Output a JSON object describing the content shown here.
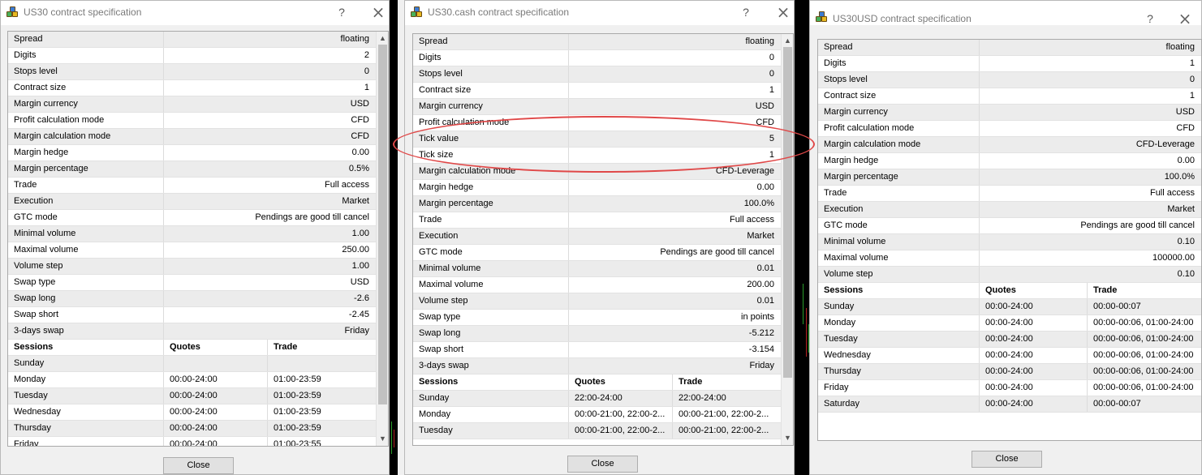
{
  "dialogs": [
    {
      "title": "US30 contract specification",
      "help": "?",
      "close_button": "Close",
      "specs": [
        {
          "k": "Spread",
          "v": "floating"
        },
        {
          "k": "Digits",
          "v": "2"
        },
        {
          "k": "Stops level",
          "v": "0"
        },
        {
          "k": "Contract size",
          "v": "1"
        },
        {
          "k": "Margin currency",
          "v": "USD"
        },
        {
          "k": "Profit calculation mode",
          "v": "CFD"
        },
        {
          "k": "Margin calculation mode",
          "v": "CFD"
        },
        {
          "k": "Margin hedge",
          "v": "0.00"
        },
        {
          "k": "Margin percentage",
          "v": "0.5%"
        },
        {
          "k": "Trade",
          "v": "Full access"
        },
        {
          "k": "Execution",
          "v": "Market"
        },
        {
          "k": "GTC mode",
          "v": "Pendings are good till cancel"
        },
        {
          "k": "Minimal volume",
          "v": "1.00"
        },
        {
          "k": "Maximal volume",
          "v": "250.00"
        },
        {
          "k": "Volume step",
          "v": "1.00"
        },
        {
          "k": "Swap type",
          "v": "USD"
        },
        {
          "k": "Swap long",
          "v": "-2.6"
        },
        {
          "k": "Swap short",
          "v": "-2.45"
        },
        {
          "k": "3-days swap",
          "v": "Friday"
        }
      ],
      "sessions_header": [
        "Sessions",
        "Quotes",
        "Trade"
      ],
      "sessions": [
        [
          "Sunday",
          "",
          ""
        ],
        [
          "Monday",
          "00:00-24:00",
          "01:00-23:59"
        ],
        [
          "Tuesday",
          "00:00-24:00",
          "01:00-23:59"
        ],
        [
          "Wednesday",
          "00:00-24:00",
          "01:00-23:59"
        ],
        [
          "Thursday",
          "00:00-24:00",
          "01:00-23:59"
        ],
        [
          "Friday",
          "00:00-24:00",
          "01:00-23:55"
        ]
      ]
    },
    {
      "title": "US30.cash contract specification",
      "help": "?",
      "close_button": "Close",
      "specs": [
        {
          "k": "Spread",
          "v": "floating"
        },
        {
          "k": "Digits",
          "v": "0"
        },
        {
          "k": "Stops level",
          "v": "0"
        },
        {
          "k": "Contract size",
          "v": "1"
        },
        {
          "k": "Margin currency",
          "v": "USD"
        },
        {
          "k": "Profit calculation mode",
          "v": "CFD"
        },
        {
          "k": "Tick value",
          "v": "5"
        },
        {
          "k": "Tick size",
          "v": "1"
        },
        {
          "k": "Margin calculation mode",
          "v": "CFD-Leverage"
        },
        {
          "k": "Margin hedge",
          "v": "0.00"
        },
        {
          "k": "Margin percentage",
          "v": "100.0%"
        },
        {
          "k": "Trade",
          "v": "Full access"
        },
        {
          "k": "Execution",
          "v": "Market"
        },
        {
          "k": "GTC mode",
          "v": "Pendings are good till cancel"
        },
        {
          "k": "Minimal volume",
          "v": "0.01"
        },
        {
          "k": "Maximal volume",
          "v": "200.00"
        },
        {
          "k": "Volume step",
          "v": "0.01"
        },
        {
          "k": "Swap type",
          "v": "in points"
        },
        {
          "k": "Swap long",
          "v": "-5.212"
        },
        {
          "k": "Swap short",
          "v": "-3.154"
        },
        {
          "k": "3-days swap",
          "v": "Friday"
        }
      ],
      "sessions_header": [
        "Sessions",
        "Quotes",
        "Trade"
      ],
      "sessions": [
        [
          "Sunday",
          "22:00-24:00",
          "22:00-24:00"
        ],
        [
          "Monday",
          "00:00-21:00, 22:00-2...",
          "00:00-21:00, 22:00-2..."
        ],
        [
          "Tuesday",
          "00:00-21:00, 22:00-2...",
          "00:00-21:00, 22:00-2..."
        ]
      ]
    },
    {
      "title": "US30USD contract specification",
      "help": "?",
      "close_button": "Close",
      "specs": [
        {
          "k": "Spread",
          "v": "floating"
        },
        {
          "k": "Digits",
          "v": "1"
        },
        {
          "k": "Stops level",
          "v": "0"
        },
        {
          "k": "Contract size",
          "v": "1"
        },
        {
          "k": "Margin currency",
          "v": "USD"
        },
        {
          "k": "Profit calculation mode",
          "v": "CFD"
        },
        {
          "k": "Margin calculation mode",
          "v": "CFD-Leverage"
        },
        {
          "k": "Margin hedge",
          "v": "0.00"
        },
        {
          "k": "Margin percentage",
          "v": "100.0%"
        },
        {
          "k": "Trade",
          "v": "Full access"
        },
        {
          "k": "Execution",
          "v": "Market"
        },
        {
          "k": "GTC mode",
          "v": "Pendings are good till cancel"
        },
        {
          "k": "Minimal volume",
          "v": "0.10"
        },
        {
          "k": "Maximal volume",
          "v": "100000.00"
        },
        {
          "k": "Volume step",
          "v": "0.10"
        }
      ],
      "sessions_header": [
        "Sessions",
        "Quotes",
        "Trade"
      ],
      "sessions": [
        [
          "Sunday",
          "00:00-24:00",
          "00:00-00:07"
        ],
        [
          "Monday",
          "00:00-24:00",
          "00:00-00:06, 01:00-24:00"
        ],
        [
          "Tuesday",
          "00:00-24:00",
          "00:00-00:06, 01:00-24:00"
        ],
        [
          "Wednesday",
          "00:00-24:00",
          "00:00-00:06, 01:00-24:00"
        ],
        [
          "Thursday",
          "00:00-24:00",
          "00:00-00:06, 01:00-24:00"
        ],
        [
          "Friday",
          "00:00-24:00",
          "00:00-00:06, 01:00-24:00"
        ],
        [
          "Saturday",
          "00:00-24:00",
          "00:00-00:07"
        ]
      ]
    }
  ]
}
